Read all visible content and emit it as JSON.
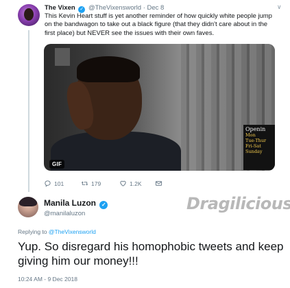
{
  "tweet1": {
    "display_name": "The Vixen",
    "handle": "@TheVixensworld",
    "separator": "·",
    "date": "Dec 8",
    "text": "This Kevin Heart stuff is yet another reminder of how quickly white people jump on the bandwagon to take out a black figure (that they didn't care about in the first place) but NEVER see the issues with their own faves.",
    "media_badge": "GIF",
    "media_sign_text": [
      "Openin",
      "Mon",
      "Tue-Thur",
      "Fri-Sat",
      "Sunday"
    ],
    "actions": {
      "replies": "101",
      "retweets": "179",
      "likes": "1.2K"
    }
  },
  "tweet2": {
    "display_name": "Manila Luzon",
    "handle": "@manilaluzon",
    "reply_prefix": "Replying to",
    "reply_handle": "@TheVixensworld",
    "text": "Yup. So disregard his homophobic tweets and keep giving him our money!!!",
    "timestamp": "10:24 AM - 9 Dec 2018"
  },
  "watermark": "Dragilicious",
  "icons": {
    "verified": "verified-badge-icon",
    "chevron": "chevron-down-icon",
    "reply": "reply-icon",
    "retweet": "retweet-icon",
    "like": "heart-icon",
    "dm": "envelope-icon"
  },
  "colors": {
    "accent": "#1da1f2",
    "muted": "#657786",
    "text": "#14171a"
  }
}
